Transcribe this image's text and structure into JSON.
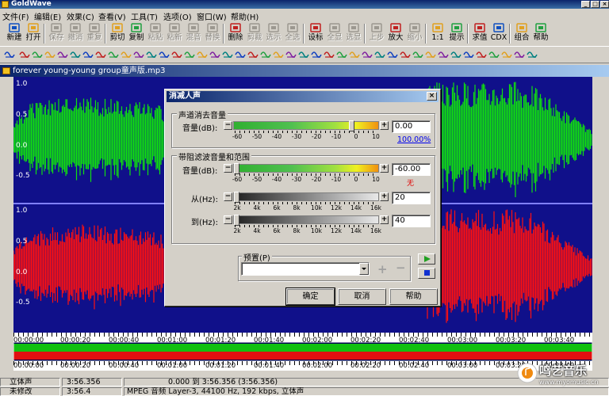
{
  "window": {
    "title": "GoldWave"
  },
  "menu": [
    "文件(F)",
    "编辑(E)",
    "效果(C)",
    "查看(V)",
    "工具(T)",
    "选项(O)",
    "窗口(W)",
    "帮助(H)"
  ],
  "toolbar": [
    {
      "label": "新建",
      "icon": "new-file-icon",
      "enabled": true
    },
    {
      "label": "打开",
      "icon": "open-folder-icon",
      "enabled": true
    },
    {
      "label": "保存",
      "icon": "save-icon",
      "enabled": false
    },
    {
      "label": "撤消",
      "icon": "undo-icon",
      "enabled": false
    },
    {
      "label": "重复",
      "icon": "redo-icon",
      "enabled": false
    },
    {
      "label": "剪切",
      "icon": "cut-icon",
      "enabled": true
    },
    {
      "label": "复制",
      "icon": "copy-icon",
      "enabled": true
    },
    {
      "label": "粘贴",
      "icon": "paste-icon",
      "enabled": false
    },
    {
      "label": "粘新",
      "icon": "paste-new-icon",
      "enabled": false
    },
    {
      "label": "混音",
      "icon": "mix-icon",
      "enabled": false
    },
    {
      "label": "替换",
      "icon": "replace-icon",
      "enabled": false
    },
    {
      "label": "删除",
      "icon": "delete-icon",
      "enabled": true
    },
    {
      "label": "剪裁",
      "icon": "trim-icon",
      "enabled": false
    },
    {
      "label": "选示",
      "icon": "select-view-icon",
      "enabled": false
    },
    {
      "label": "全选",
      "icon": "select-all-icon",
      "enabled": false
    },
    {
      "label": "设标",
      "icon": "set-marker-icon",
      "enabled": true
    },
    {
      "label": "全显",
      "icon": "show-all-icon",
      "enabled": false
    },
    {
      "label": "选显",
      "icon": "show-selection-icon",
      "enabled": false
    },
    {
      "label": "上步",
      "icon": "previous-icon",
      "enabled": false
    },
    {
      "label": "放大",
      "icon": "zoom-in-icon",
      "enabled": true
    },
    {
      "label": "缩小",
      "icon": "zoom-out-icon",
      "enabled": false
    },
    {
      "label": "1:1",
      "icon": "zoom-1to1-icon",
      "enabled": true
    },
    {
      "label": "提示",
      "icon": "cue-icon",
      "enabled": true
    },
    {
      "label": "求值",
      "icon": "evaluate-icon",
      "enabled": true
    },
    {
      "label": "CDX",
      "icon": "cdx-icon",
      "enabled": true
    },
    {
      "label": "组合",
      "icon": "group-icon",
      "enabled": true
    },
    {
      "label": "帮助",
      "icon": "help-icon",
      "enabled": true
    }
  ],
  "sound_window": {
    "title": "forever young-young group童声版.mp3",
    "axis_labels_top": [
      "1.0",
      "0.5",
      "0.0",
      "-0.5"
    ],
    "axis_labels_bottom": [
      "1.0",
      "0.5",
      "0.0",
      "-0.5"
    ],
    "timeline": [
      "00:00:00",
      "00:00:20",
      "00:00:40",
      "00:01:00",
      "00:01:20",
      "00:01:40",
      "00:02:00",
      "00:02:20",
      "00:02:40",
      "00:03:00",
      "00:03:20",
      "00:03:40"
    ],
    "timeline2": [
      "00:00:00",
      "00:00:20",
      "00:00:40",
      "00:01:00",
      "00:01:20",
      "00:01:40",
      "00:02:00",
      "00:02:20",
      "00:02:40",
      "00:03:00",
      "00:03:20",
      "00:03:40"
    ]
  },
  "dialog": {
    "title": "消减人声",
    "group1": {
      "title": "声道消去音量",
      "volume_label": "音量(dB):",
      "volume_value": "0.00",
      "percent_link": "100.00%",
      "scale": [
        "-60",
        "-50",
        "-40",
        "-30",
        "-20",
        "-10",
        "0",
        "10"
      ]
    },
    "group2": {
      "title": "带阻滤波音量和范围",
      "volume_label": "音量(dB):",
      "volume_value": "-60.00",
      "volume_note": "无",
      "scale": [
        "-60",
        "-50",
        "-40",
        "-30",
        "-20",
        "-10",
        "0",
        "10"
      ],
      "from_label": "从(Hz):",
      "from_value": "20",
      "to_label": "到(Hz):",
      "to_value": "40",
      "freq_scale": [
        "2k",
        "4k",
        "6k",
        "8k",
        "10k",
        "12k",
        "14k",
        "16k"
      ]
    },
    "preset": {
      "label": "预置(P)",
      "value": ""
    },
    "buttons": {
      "ok": "确定",
      "cancel": "取消",
      "help": "帮助"
    }
  },
  "status": {
    "row1": [
      "立体声",
      "3:56.356",
      "0.000 到 3:56.356 (3:56.356)"
    ],
    "row2": [
      "未修改",
      "3:56.4",
      "MPEG 音频 Layer-3, 44100 Hz, 192 kbps, 立体声"
    ]
  },
  "watermark": {
    "name": "鸣艺音乐",
    "url": "www.myomusic.cn"
  },
  "colors": {
    "left_channel": "#10e010",
    "right_channel": "#ff1010",
    "wave_bg": "#10108a",
    "title_bar": "#0a246a"
  }
}
